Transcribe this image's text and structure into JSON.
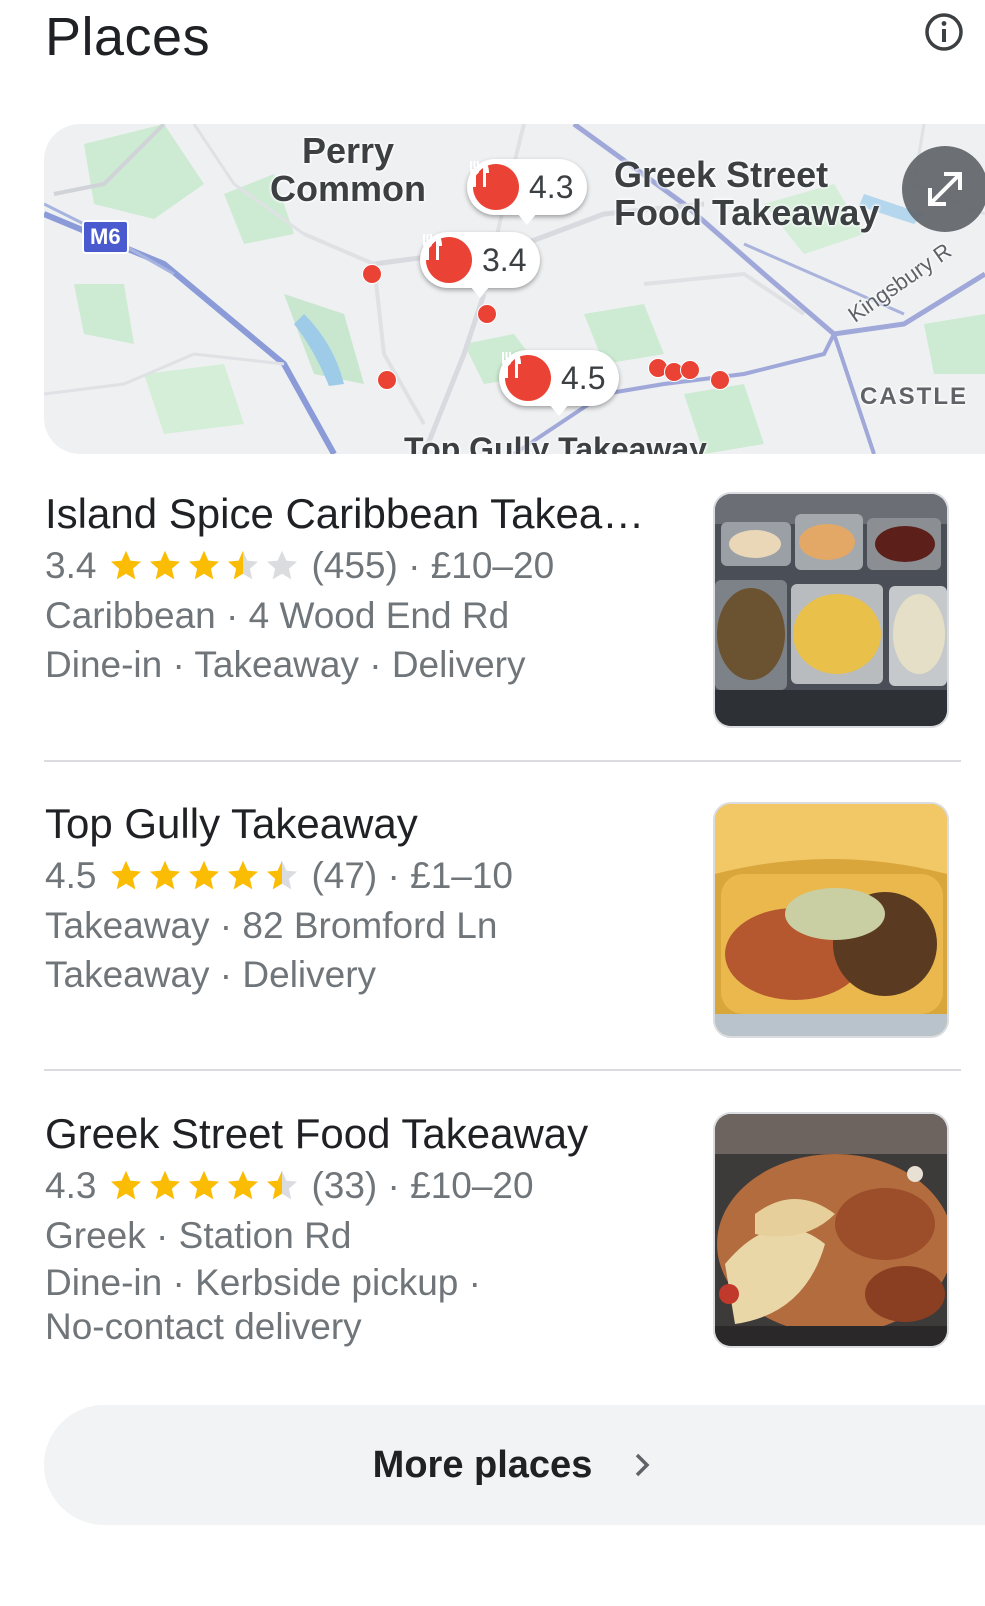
{
  "header": {
    "title": "Places"
  },
  "map": {
    "labels": {
      "perry": "Perry\nCommon",
      "greek": "Greek Street\nFood Takeaway",
      "top_gully": "Top Gully Takeaway",
      "kingsbury": "Kingsbury R",
      "castle": "CASTLE",
      "m6": "M6"
    },
    "pins": [
      {
        "rating": "4.3"
      },
      {
        "rating": "3.4"
      },
      {
        "rating": "4.5"
      }
    ]
  },
  "places": [
    {
      "name": "Island Spice Caribbean Takea…",
      "rating": "3.4",
      "stars": 3.4,
      "reviews": "(455) · £10–20",
      "line1": "Caribbean · 4 Wood End Rd",
      "line2": "Dine-in · Takeaway · Delivery",
      "line3": ""
    },
    {
      "name": "Top Gully Takeaway",
      "rating": "4.5",
      "stars": 4.5,
      "reviews": "(47) · £1–10",
      "line1": "Takeaway · 82 Bromford Ln",
      "line2": "Takeaway · Delivery",
      "line3": ""
    },
    {
      "name": "Greek Street Food Takeaway",
      "rating": "4.3",
      "stars": 4.3,
      "reviews": "(33) · £10–20",
      "line1": "Greek · Station Rd",
      "line2": "Dine-in · Kerbside pickup ·",
      "line3": "No-contact delivery"
    }
  ],
  "more_button": {
    "label": "More places"
  },
  "colors": {
    "pin": "#ea4335",
    "star": "#fbbc04",
    "star_empty": "#dadce0"
  }
}
